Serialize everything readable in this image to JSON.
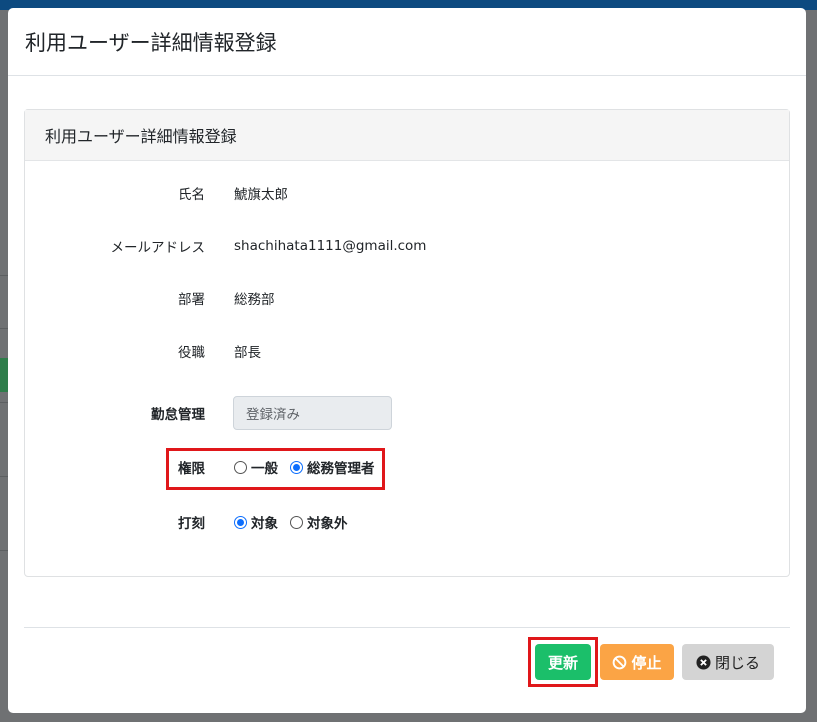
{
  "modal": {
    "title": "利用ユーザー詳細情報登録",
    "card_title": "利用ユーザー詳細情報登録"
  },
  "fields": {
    "name": {
      "label": "氏名",
      "value": "鯱旗太郎"
    },
    "email": {
      "label": "メールアドレス",
      "value": "shachihata1111@gmail.com"
    },
    "department": {
      "label": "部署",
      "value": "総務部"
    },
    "position": {
      "label": "役職",
      "value": "部長"
    },
    "attendance": {
      "label": "勤怠管理",
      "value": "登録済み"
    },
    "permission": {
      "label": "権限",
      "options": [
        "一般",
        "総務管理者"
      ],
      "selected": "総務管理者"
    },
    "stamp": {
      "label": "打刻",
      "options": [
        "対象",
        "対象外"
      ],
      "selected": "対象"
    }
  },
  "buttons": {
    "update": "更新",
    "stop": "停止",
    "close": "閉じる"
  },
  "colors": {
    "update": "#1bbf6a",
    "stop": "#fba445",
    "close": "#d4d4d4",
    "highlight": "#e0171a",
    "radio_accent": "#0d6efd"
  }
}
